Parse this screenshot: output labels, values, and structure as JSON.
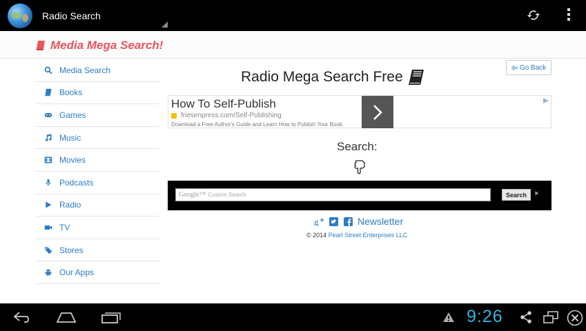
{
  "actionbar": {
    "title": "Radio Search",
    "refresh_icon": "refresh-icon",
    "overflow_icon": "overflow-menu-icon"
  },
  "brand": {
    "text": "Media Mega Search!",
    "color": "#e8565c"
  },
  "sidebar": {
    "items": [
      {
        "label": "Media Search",
        "icon": "search-icon"
      },
      {
        "label": "Books",
        "icon": "book-icon"
      },
      {
        "label": "Games",
        "icon": "gamepad-icon"
      },
      {
        "label": "Music",
        "icon": "music-icon"
      },
      {
        "label": "Movies",
        "icon": "film-icon"
      },
      {
        "label": "Podcasts",
        "icon": "microphone-icon"
      },
      {
        "label": "Radio",
        "icon": "play-icon"
      },
      {
        "label": "TV",
        "icon": "video-camera-icon"
      },
      {
        "label": "Stores",
        "icon": "tags-icon"
      },
      {
        "label": "Our Apps",
        "icon": "android-icon"
      }
    ]
  },
  "main": {
    "go_back": "Go Back",
    "title": "Radio Mega Search Free",
    "ad": {
      "headline": "How To Self-Publish",
      "url": "friesenpress.com/Self-Publishing",
      "description": "Download a Free Author's Guide and Learn How to Publish Your Book."
    },
    "search_label": "Search:",
    "search": {
      "placeholder_brand": "Google™",
      "placeholder": "Custom Search",
      "button": "Search",
      "close": "×"
    },
    "social": {
      "newsletter": "Newsletter"
    },
    "copyright": {
      "prefix": "© 2014 ",
      "company": "Pearl Street Enterprises LLC"
    }
  },
  "sysbar": {
    "clock": "9:26"
  },
  "colors": {
    "link": "#2b7cc3",
    "accent": "#33b5e5",
    "brand": "#e8565c"
  }
}
